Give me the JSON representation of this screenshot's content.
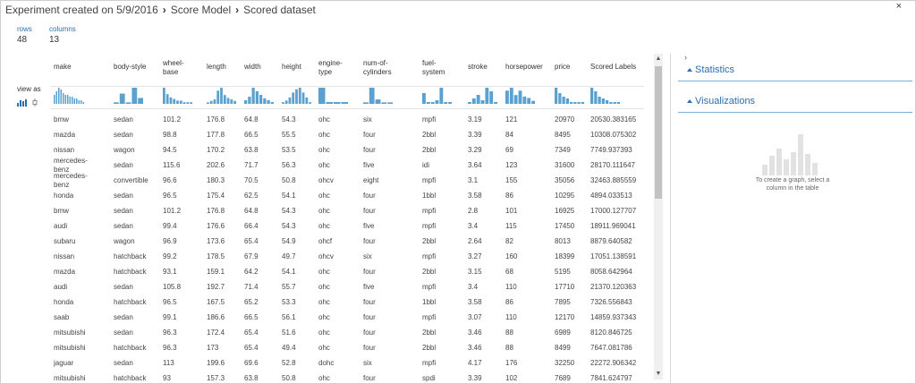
{
  "breadcrumb": [
    "Experiment created on 5/9/2016",
    "Score Model",
    "Scored dataset"
  ],
  "close_glyph": "×",
  "stats": {
    "rows_label": "rows",
    "rows_value": "48",
    "columns_label": "columns",
    "columns_value": "13"
  },
  "view_as_label": "view as",
  "columns": [
    {
      "key": "make",
      "label": "make"
    },
    {
      "key": "body_style",
      "label": "body-style"
    },
    {
      "key": "wheel_base",
      "label": "wheel-\nbase"
    },
    {
      "key": "length",
      "label": "length"
    },
    {
      "key": "width",
      "label": "width"
    },
    {
      "key": "height",
      "label": "height"
    },
    {
      "key": "engine_type",
      "label": "engine-\ntype"
    },
    {
      "key": "num_of_cylinders",
      "label": "num-of-\ncylinders"
    },
    {
      "key": "fuel_system",
      "label": "fuel-\nsystem"
    },
    {
      "key": "stroke",
      "label": "stroke"
    },
    {
      "key": "horsepower",
      "label": "horsepower"
    },
    {
      "key": "price",
      "label": "price"
    },
    {
      "key": "scored_labels",
      "label": "Scored Labels"
    }
  ],
  "histograms": [
    [
      5,
      7,
      9,
      8,
      6,
      5,
      5,
      4,
      4,
      3,
      3,
      2,
      2,
      1
    ],
    [
      1,
      7,
      1,
      11,
      4
    ],
    [
      10,
      6,
      4,
      3,
      2,
      2,
      1,
      1,
      1
    ],
    [
      1,
      2,
      3,
      9,
      11,
      6,
      4,
      3,
      2
    ],
    [
      2,
      4,
      9,
      7,
      5,
      3,
      2,
      1
    ],
    [
      1,
      2,
      4,
      7,
      9,
      10,
      7,
      4,
      1
    ],
    [
      9,
      1,
      1,
      1
    ],
    [
      1,
      11,
      3,
      1,
      1
    ],
    [
      6,
      1,
      1,
      2,
      9,
      1,
      1
    ],
    [
      1,
      3,
      5,
      2,
      9,
      7,
      1
    ],
    [
      9,
      11,
      6,
      9,
      5,
      4,
      2
    ],
    [
      9,
      6,
      4,
      3,
      1,
      1,
      1,
      1
    ],
    [
      9,
      7,
      4,
      3,
      2,
      1,
      1,
      1
    ]
  ],
  "rows": [
    [
      "bmw",
      "sedan",
      "101.2",
      "176.8",
      "64.8",
      "54.3",
      "ohc",
      "six",
      "mpfi",
      "3.19",
      "121",
      "20970",
      "20530.383165"
    ],
    [
      "mazda",
      "sedan",
      "98.8",
      "177.8",
      "66.5",
      "55.5",
      "ohc",
      "four",
      "2bbl",
      "3.39",
      "84",
      "8495",
      "10308.075302"
    ],
    [
      "nissan",
      "wagon",
      "94.5",
      "170.2",
      "63.8",
      "53.5",
      "ohc",
      "four",
      "2bbl",
      "3.29",
      "69",
      "7349",
      "7749.937393"
    ],
    [
      "mercedes-\nbenz",
      "sedan",
      "115.6",
      "202.6",
      "71.7",
      "56.3",
      "ohc",
      "five",
      "idi",
      "3.64",
      "123",
      "31600",
      "28170.111647"
    ],
    [
      "mercedes-\nbenz",
      "convertible",
      "96.6",
      "180.3",
      "70.5",
      "50.8",
      "ohcv",
      "eight",
      "mpfi",
      "3.1",
      "155",
      "35056",
      "32463.885559"
    ],
    [
      "honda",
      "sedan",
      "96.5",
      "175.4",
      "62.5",
      "54.1",
      "ohc",
      "four",
      "1bbl",
      "3.58",
      "86",
      "10295",
      "4894.033513"
    ],
    [
      "bmw",
      "sedan",
      "101.2",
      "176.8",
      "64.8",
      "54.3",
      "ohc",
      "four",
      "mpfi",
      "2.8",
      "101",
      "16925",
      "17000.127707"
    ],
    [
      "audi",
      "sedan",
      "99.4",
      "176.6",
      "66.4",
      "54.3",
      "ohc",
      "five",
      "mpfi",
      "3.4",
      "115",
      "17450",
      "18911.969041"
    ],
    [
      "subaru",
      "wagon",
      "96.9",
      "173.6",
      "65.4",
      "54.9",
      "ohcf",
      "four",
      "2bbl",
      "2.64",
      "82",
      "8013",
      "8879.640582"
    ],
    [
      "nissan",
      "hatchback",
      "99.2",
      "178.5",
      "67.9",
      "49.7",
      "ohcv",
      "six",
      "mpfi",
      "3.27",
      "160",
      "18399",
      "17051.138591"
    ],
    [
      "mazda",
      "hatchback",
      "93.1",
      "159.1",
      "64.2",
      "54.1",
      "ohc",
      "four",
      "2bbl",
      "3.15",
      "68",
      "5195",
      "8058.642964"
    ],
    [
      "audi",
      "sedan",
      "105.8",
      "192.7",
      "71.4",
      "55.7",
      "ohc",
      "five",
      "mpfi",
      "3.4",
      "110",
      "17710",
      "21370.120363"
    ],
    [
      "honda",
      "hatchback",
      "96.5",
      "167.5",
      "65.2",
      "53.3",
      "ohc",
      "four",
      "1bbl",
      "3.58",
      "86",
      "7895",
      "7326.556843"
    ],
    [
      "saab",
      "sedan",
      "99.1",
      "186.6",
      "66.5",
      "56.1",
      "ohc",
      "four",
      "mpfi",
      "3.07",
      "110",
      "12170",
      "14859.937343"
    ],
    [
      "mitsubishi",
      "sedan",
      "96.3",
      "172.4",
      "65.4",
      "51.6",
      "ohc",
      "four",
      "2bbl",
      "3.46",
      "88",
      "6989",
      "8120.846725"
    ],
    [
      "mitsubishi",
      "hatchback",
      "96.3",
      "173",
      "65.4",
      "49.4",
      "ohc",
      "four",
      "2bbl",
      "3.46",
      "88",
      "8499",
      "7647.081786"
    ],
    [
      "jaguar",
      "sedan",
      "113",
      "199.6",
      "69.6",
      "52.8",
      "dohc",
      "six",
      "mpfi",
      "4.17",
      "176",
      "32250",
      "22272.906342"
    ],
    [
      "mitsubishi",
      "hatchback",
      "93",
      "157.3",
      "63.8",
      "50.8",
      "ohc",
      "four",
      "spdi",
      "3.39",
      "102",
      "7689",
      "7841.624797"
    ]
  ],
  "right_panel": {
    "sections": [
      "Statistics",
      "Visualizations"
    ],
    "hint": "To create a graph, select a column in the table"
  },
  "colors": {
    "accent": "#2a6fb0",
    "bar": "#5aa1cf",
    "ghost_bar": "#e2e2e2"
  }
}
